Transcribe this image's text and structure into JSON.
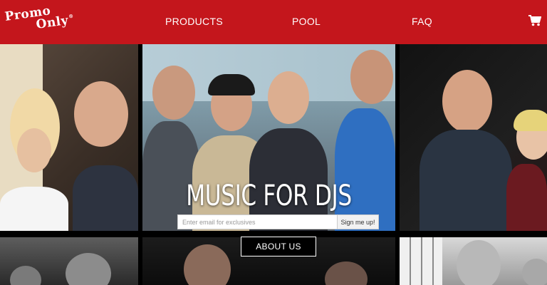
{
  "header": {
    "logo_line1": "Promo",
    "logo_line2": "Only",
    "logo_reg": "®",
    "nav": [
      {
        "label": "PRODUCTS"
      },
      {
        "label": "POOL"
      },
      {
        "label": "FAQ"
      }
    ],
    "cart_icon": "shopping-cart-icon",
    "brand_color": "#c4161c"
  },
  "hero": {
    "title": "MUSIC FOR DJS",
    "email_placeholder": "Enter email for exclusives",
    "signup_label": "Sign me up!",
    "about_label": "ABOUT US"
  }
}
